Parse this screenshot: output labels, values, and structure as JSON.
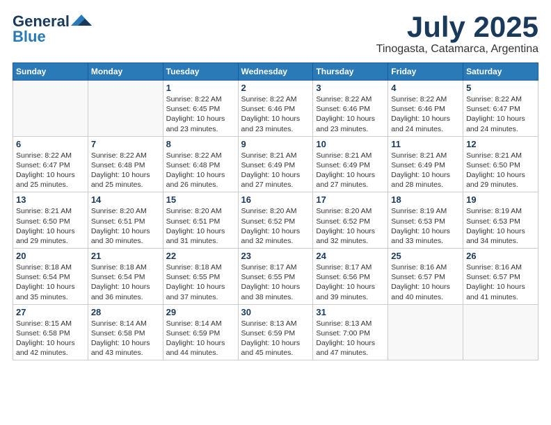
{
  "logo": {
    "line1": "General",
    "line2": "Blue"
  },
  "title": "July 2025",
  "location": "Tinogasta, Catamarca, Argentina",
  "weekdays": [
    "Sunday",
    "Monday",
    "Tuesday",
    "Wednesday",
    "Thursday",
    "Friday",
    "Saturday"
  ],
  "weeks": [
    [
      {
        "day": "",
        "info": ""
      },
      {
        "day": "",
        "info": ""
      },
      {
        "day": "1",
        "info": "Sunrise: 8:22 AM\nSunset: 6:45 PM\nDaylight: 10 hours\nand 23 minutes."
      },
      {
        "day": "2",
        "info": "Sunrise: 8:22 AM\nSunset: 6:46 PM\nDaylight: 10 hours\nand 23 minutes."
      },
      {
        "day": "3",
        "info": "Sunrise: 8:22 AM\nSunset: 6:46 PM\nDaylight: 10 hours\nand 23 minutes."
      },
      {
        "day": "4",
        "info": "Sunrise: 8:22 AM\nSunset: 6:46 PM\nDaylight: 10 hours\nand 24 minutes."
      },
      {
        "day": "5",
        "info": "Sunrise: 8:22 AM\nSunset: 6:47 PM\nDaylight: 10 hours\nand 24 minutes."
      }
    ],
    [
      {
        "day": "6",
        "info": "Sunrise: 8:22 AM\nSunset: 6:47 PM\nDaylight: 10 hours\nand 25 minutes."
      },
      {
        "day": "7",
        "info": "Sunrise: 8:22 AM\nSunset: 6:48 PM\nDaylight: 10 hours\nand 25 minutes."
      },
      {
        "day": "8",
        "info": "Sunrise: 8:22 AM\nSunset: 6:48 PM\nDaylight: 10 hours\nand 26 minutes."
      },
      {
        "day": "9",
        "info": "Sunrise: 8:21 AM\nSunset: 6:49 PM\nDaylight: 10 hours\nand 27 minutes."
      },
      {
        "day": "10",
        "info": "Sunrise: 8:21 AM\nSunset: 6:49 PM\nDaylight: 10 hours\nand 27 minutes."
      },
      {
        "day": "11",
        "info": "Sunrise: 8:21 AM\nSunset: 6:49 PM\nDaylight: 10 hours\nand 28 minutes."
      },
      {
        "day": "12",
        "info": "Sunrise: 8:21 AM\nSunset: 6:50 PM\nDaylight: 10 hours\nand 29 minutes."
      }
    ],
    [
      {
        "day": "13",
        "info": "Sunrise: 8:21 AM\nSunset: 6:50 PM\nDaylight: 10 hours\nand 29 minutes."
      },
      {
        "day": "14",
        "info": "Sunrise: 8:20 AM\nSunset: 6:51 PM\nDaylight: 10 hours\nand 30 minutes."
      },
      {
        "day": "15",
        "info": "Sunrise: 8:20 AM\nSunset: 6:51 PM\nDaylight: 10 hours\nand 31 minutes."
      },
      {
        "day": "16",
        "info": "Sunrise: 8:20 AM\nSunset: 6:52 PM\nDaylight: 10 hours\nand 32 minutes."
      },
      {
        "day": "17",
        "info": "Sunrise: 8:20 AM\nSunset: 6:52 PM\nDaylight: 10 hours\nand 32 minutes."
      },
      {
        "day": "18",
        "info": "Sunrise: 8:19 AM\nSunset: 6:53 PM\nDaylight: 10 hours\nand 33 minutes."
      },
      {
        "day": "19",
        "info": "Sunrise: 8:19 AM\nSunset: 6:53 PM\nDaylight: 10 hours\nand 34 minutes."
      }
    ],
    [
      {
        "day": "20",
        "info": "Sunrise: 8:18 AM\nSunset: 6:54 PM\nDaylight: 10 hours\nand 35 minutes."
      },
      {
        "day": "21",
        "info": "Sunrise: 8:18 AM\nSunset: 6:54 PM\nDaylight: 10 hours\nand 36 minutes."
      },
      {
        "day": "22",
        "info": "Sunrise: 8:18 AM\nSunset: 6:55 PM\nDaylight: 10 hours\nand 37 minutes."
      },
      {
        "day": "23",
        "info": "Sunrise: 8:17 AM\nSunset: 6:55 PM\nDaylight: 10 hours\nand 38 minutes."
      },
      {
        "day": "24",
        "info": "Sunrise: 8:17 AM\nSunset: 6:56 PM\nDaylight: 10 hours\nand 39 minutes."
      },
      {
        "day": "25",
        "info": "Sunrise: 8:16 AM\nSunset: 6:57 PM\nDaylight: 10 hours\nand 40 minutes."
      },
      {
        "day": "26",
        "info": "Sunrise: 8:16 AM\nSunset: 6:57 PM\nDaylight: 10 hours\nand 41 minutes."
      }
    ],
    [
      {
        "day": "27",
        "info": "Sunrise: 8:15 AM\nSunset: 6:58 PM\nDaylight: 10 hours\nand 42 minutes."
      },
      {
        "day": "28",
        "info": "Sunrise: 8:14 AM\nSunset: 6:58 PM\nDaylight: 10 hours\nand 43 minutes."
      },
      {
        "day": "29",
        "info": "Sunrise: 8:14 AM\nSunset: 6:59 PM\nDaylight: 10 hours\nand 44 minutes."
      },
      {
        "day": "30",
        "info": "Sunrise: 8:13 AM\nSunset: 6:59 PM\nDaylight: 10 hours\nand 45 minutes."
      },
      {
        "day": "31",
        "info": "Sunrise: 8:13 AM\nSunset: 7:00 PM\nDaylight: 10 hours\nand 47 minutes."
      },
      {
        "day": "",
        "info": ""
      },
      {
        "day": "",
        "info": ""
      }
    ]
  ]
}
